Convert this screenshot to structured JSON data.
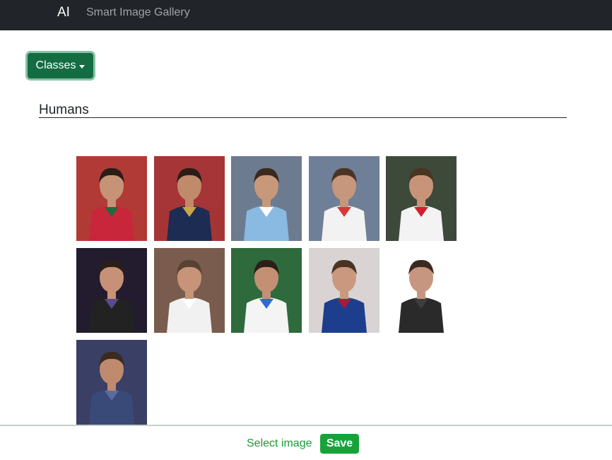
{
  "navbar": {
    "brand": "AI",
    "title": "Smart Image Gallery"
  },
  "classes_dropdown": {
    "label": "Classes"
  },
  "section": {
    "heading": "Humans"
  },
  "gallery": {
    "images": [
      {
        "subject": "footballer-red-green-kit",
        "colors": {
          "bg": "#b23a36",
          "shirt": "#c8263a",
          "accent": "#1f6b3b",
          "skin": "#c79377",
          "hair": "#2a1d16"
        }
      },
      {
        "subject": "footballer-navy-kit",
        "colors": {
          "bg": "#a53536",
          "shirt": "#1d2c52",
          "accent": "#c7a64a",
          "skin": "#c08a6b",
          "hair": "#2a1d16"
        }
      },
      {
        "subject": "footballer-striped-kit",
        "colors": {
          "bg": "#6c7b8f",
          "shirt": "#8ab9e2",
          "accent": "#ffffff",
          "skin": "#c8987a",
          "hair": "#3a2a1e"
        }
      },
      {
        "subject": "tennis-player-white-headband",
        "colors": {
          "bg": "#6f7f97",
          "shirt": "#f2f2f2",
          "accent": "#d53a3a",
          "skin": "#c6977c",
          "hair": "#4a3424"
        }
      },
      {
        "subject": "tennis-player-headband-looking-up",
        "colors": {
          "bg": "#3d4a3a",
          "shirt": "#f3f3f3",
          "accent": "#d3202e",
          "skin": "#c89479",
          "hair": "#4a3424"
        }
      },
      {
        "subject": "man-black-shirt-dark-background",
        "colors": {
          "bg": "#231c2f",
          "shirt": "#222222",
          "accent": "#5b4a8a",
          "skin": "#c79177",
          "hair": "#2a1e18"
        }
      },
      {
        "subject": "tennis-player-smiling",
        "colors": {
          "bg": "#7a5c4e",
          "shirt": "#f1f1f1",
          "accent": "#ffffff",
          "skin": "#c79479",
          "hair": "#5a4232"
        }
      },
      {
        "subject": "footballer-white-kit",
        "colors": {
          "bg": "#2f6a3c",
          "shirt": "#f4f4f4",
          "accent": "#2f6bd1",
          "skin": "#c39074",
          "hair": "#2b1f17"
        }
      },
      {
        "subject": "footballer-blue-red-kit-portrait",
        "colors": {
          "bg": "#d9d4d3",
          "shirt": "#1c3e8c",
          "accent": "#a51c39",
          "skin": "#c9987e",
          "hair": "#4a3323"
        }
      },
      {
        "subject": "man-smiling-portrait",
        "colors": {
          "bg": "#ffffff",
          "shirt": "#2a2a2a",
          "accent": "#3d3d3d",
          "skin": "#c79680",
          "hair": "#3b2a1f"
        }
      },
      {
        "subject": "man-looking-up-portrait",
        "colors": {
          "bg": "#3a3f66",
          "shirt": "#3a4a78",
          "accent": "#5b6aa0",
          "skin": "#c08a6e",
          "hair": "#3b2a1f"
        }
      }
    ]
  },
  "footer": {
    "select_text": "Select image",
    "save_label": "Save"
  }
}
